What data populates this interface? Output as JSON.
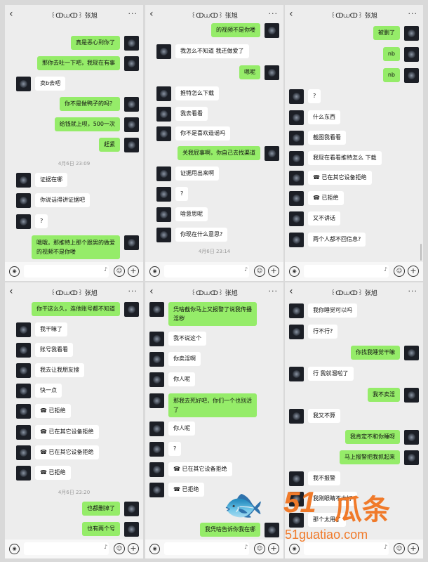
{
  "chat_title": "꒰ↀ⩊ↀ꒱ 张旭",
  "icons": {
    "back": "chevron-left-icon",
    "more": "more-icon",
    "voice": "voice-icon",
    "emoji": "emoji-icon",
    "plus": "plus-icon",
    "mic": "mic-icon"
  },
  "p1": {
    "m1": "真是恶心到你了",
    "m2": "那你去吐一下吧，我现在有事",
    "m3": "卖b去吧",
    "m4": "你不是做鸭子的吗？",
    "m5": "给钱就上呗，500一次",
    "m6": "赶紧",
    "ts": "4月6日 23:09",
    "m7": "证据在哪",
    "m8": "你说话得讲证据吧",
    "m9": "?",
    "m10a": "哦哦，那推特上那个跟男的做爱",
    "m10b": "的视频不是你喽"
  },
  "p2": {
    "m1": "的视频不是你喽",
    "m2": "我怎么不知道 我还做爱了",
    "m3": "嗯呢",
    "m4": "推特怎么下载",
    "m5": "我去看看",
    "m6": "你不是喜欢造谣吗",
    "m7": "关我屁事啊，你自己去找渠道",
    "m8": "证据甩出来啊",
    "m9": "?",
    "m10": "啥意思呢",
    "m11": "你现在什么意思?",
    "ts": "4月6日 23:14"
  },
  "p3": {
    "m1": "被删了",
    "m2": "nb",
    "m3": "nb",
    "m4": "?",
    "m5": "什么东西",
    "m6": "截图我看看",
    "m7": "我现在看看推特怎么 下载",
    "m8": "已在其它设备拒绝",
    "m9": "已拒绝",
    "m10": "又不讲话",
    "m11": "两个人都不回信息?"
  },
  "p4": {
    "m1": "你干这么久，连他账号都不知道",
    "m2": "我干嘛了",
    "m3": "账号我看看",
    "m4": "我去让我朋友搜",
    "m5": "快一点",
    "m6": "已拒绝",
    "m7": "已在其它设备拒绝",
    "m8": "已在其它设备拒绝",
    "m9": "已拒绝",
    "ts": "4月6日 23:20",
    "m10": "也都删掉了",
    "m11": "也有两个号"
  },
  "p5": {
    "m1a": "凭啥截你马上又报警了说我传播",
    "m1b": "淫秽",
    "m2": "我不说这个",
    "m3": "你卖淫啊",
    "m4": "你人呢",
    "m5a": "那我去死好吧，你们一个也别活",
    "m5b": "了",
    "m6": "你人呢",
    "m7": "?",
    "m8": "已在其它设备拒绝",
    "m9": "已拒绝",
    "m10": "我凭啥告诉你我在哪"
  },
  "p6": {
    "m1": "我你睡觉可以吗",
    "m2": "行不行?",
    "m3": "你找我睡觉干嘛",
    "m4": "行 我就溜啦了",
    "m5": "我不卖淫",
    "m6": "我又不算",
    "m7": "我肯定不和你睡呀",
    "m8": "马上报警把我抓起来",
    "m9": "我不报警",
    "m10": "我刚眼睛不太好",
    "m11": "那个太用了"
  },
  "watermark": {
    "num": "51",
    "cn": "瓜条",
    "url": "51guatiao.com"
  }
}
